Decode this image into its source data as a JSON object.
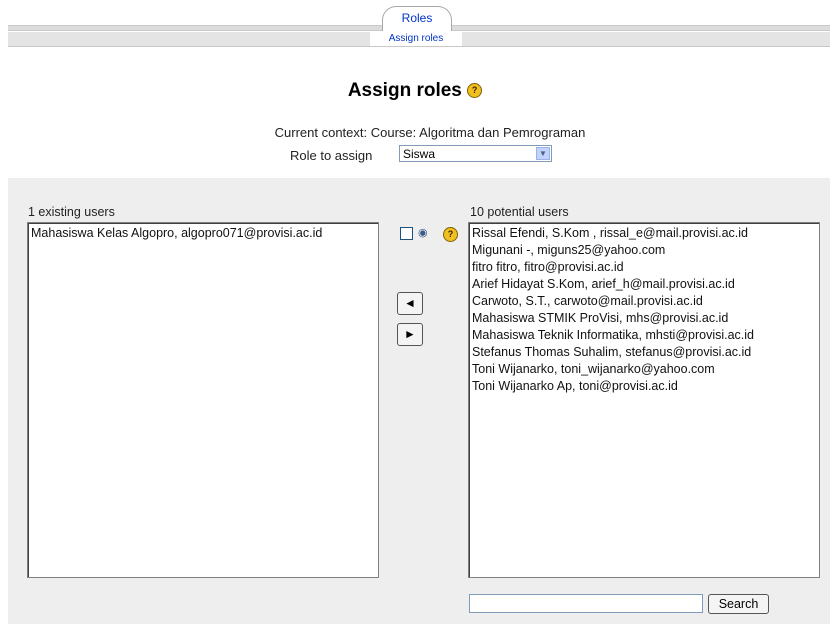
{
  "tabs": {
    "primary": "Roles",
    "secondary": "Assign roles"
  },
  "page": {
    "title": "Assign roles",
    "context": "Current context: Course: Algoritma dan Pemrograman",
    "role_label": "Role to assign",
    "role_selected": "Siswa"
  },
  "existing": {
    "caption": "1 existing users",
    "users": [
      "Mahasiswa Kelas Algopro, algopro071@provisi.ac.id"
    ]
  },
  "potential": {
    "caption": "10 potential users",
    "users": [
      "Rissal Efendi, S.Kom , rissal_e@mail.provisi.ac.id",
      "Migunani -, miguns25@yahoo.com",
      "fitro fitro, fitro@provisi.ac.id",
      "Arief Hidayat S.Kom, arief_h@mail.provisi.ac.id",
      "Carwoto, S.T., carwoto@mail.provisi.ac.id",
      "Mahasiswa STMIK ProVisi, mhs@provisi.ac.id",
      "Mahasiswa Teknik Informatika, mhsti@provisi.ac.id",
      "Stefanus Thomas Suhalim, stefanus@provisi.ac.id",
      "Toni Wijanarko, toni_wijanarko@yahoo.com",
      "Toni Wijanarko Ap, toni@provisi.ac.id"
    ]
  },
  "controls": {
    "move_left": "◄",
    "move_right": "►",
    "search_label": "Search",
    "search_value": "",
    "help_glyph": "?"
  },
  "icons": {
    "help": "help-icon",
    "eye": "eye-icon",
    "dropdown": "chevron-down-icon"
  }
}
